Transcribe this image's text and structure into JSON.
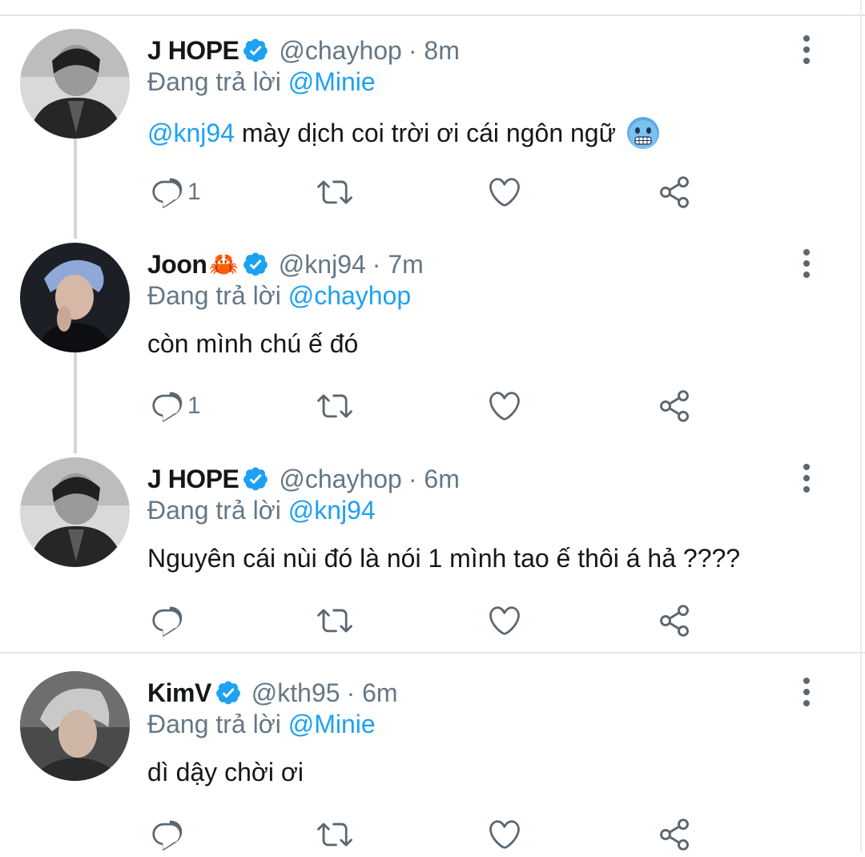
{
  "colors": {
    "accent": "#1da1f2",
    "muted": "#657786",
    "verified": "#1da1f2"
  },
  "labels": {
    "replying_to": "Đang trả lời"
  },
  "tweets": [
    {
      "name": "J HOPE",
      "name_emoji": "",
      "verified": true,
      "handle": "@chayhop",
      "time": "· 8m",
      "reply_to": "@Minie",
      "mention": "@knj94",
      "text": " mày dịch coi trời ơi cái ngôn ngữ",
      "emoji": "cold-face-emoji",
      "reply_count": "1",
      "avatar": "avatar-jhope"
    },
    {
      "name": "Joon",
      "name_emoji": "🦀",
      "verified": true,
      "handle": "@knj94",
      "time": "· 7m",
      "reply_to": "@chayhop",
      "mention": "",
      "text": "còn mình chú ế đó",
      "emoji": "",
      "reply_count": "1",
      "avatar": "avatar-joon"
    },
    {
      "name": "J HOPE",
      "name_emoji": "",
      "verified": true,
      "handle": "@chayhop",
      "time": "· 6m",
      "reply_to": "@knj94",
      "mention": "",
      "text": "Nguyên cái nùi đó là nói 1 mình tao ế thôi á hả ????",
      "emoji": "",
      "reply_count": "",
      "avatar": "avatar-jhope"
    },
    {
      "name": "KimV",
      "name_emoji": "",
      "verified": true,
      "handle": "@kth95",
      "time": "· 6m",
      "reply_to": "@Minie",
      "mention": "",
      "text": "dì dậy chời ơi",
      "emoji": "",
      "reply_count": "",
      "avatar": "avatar-kimv"
    }
  ]
}
